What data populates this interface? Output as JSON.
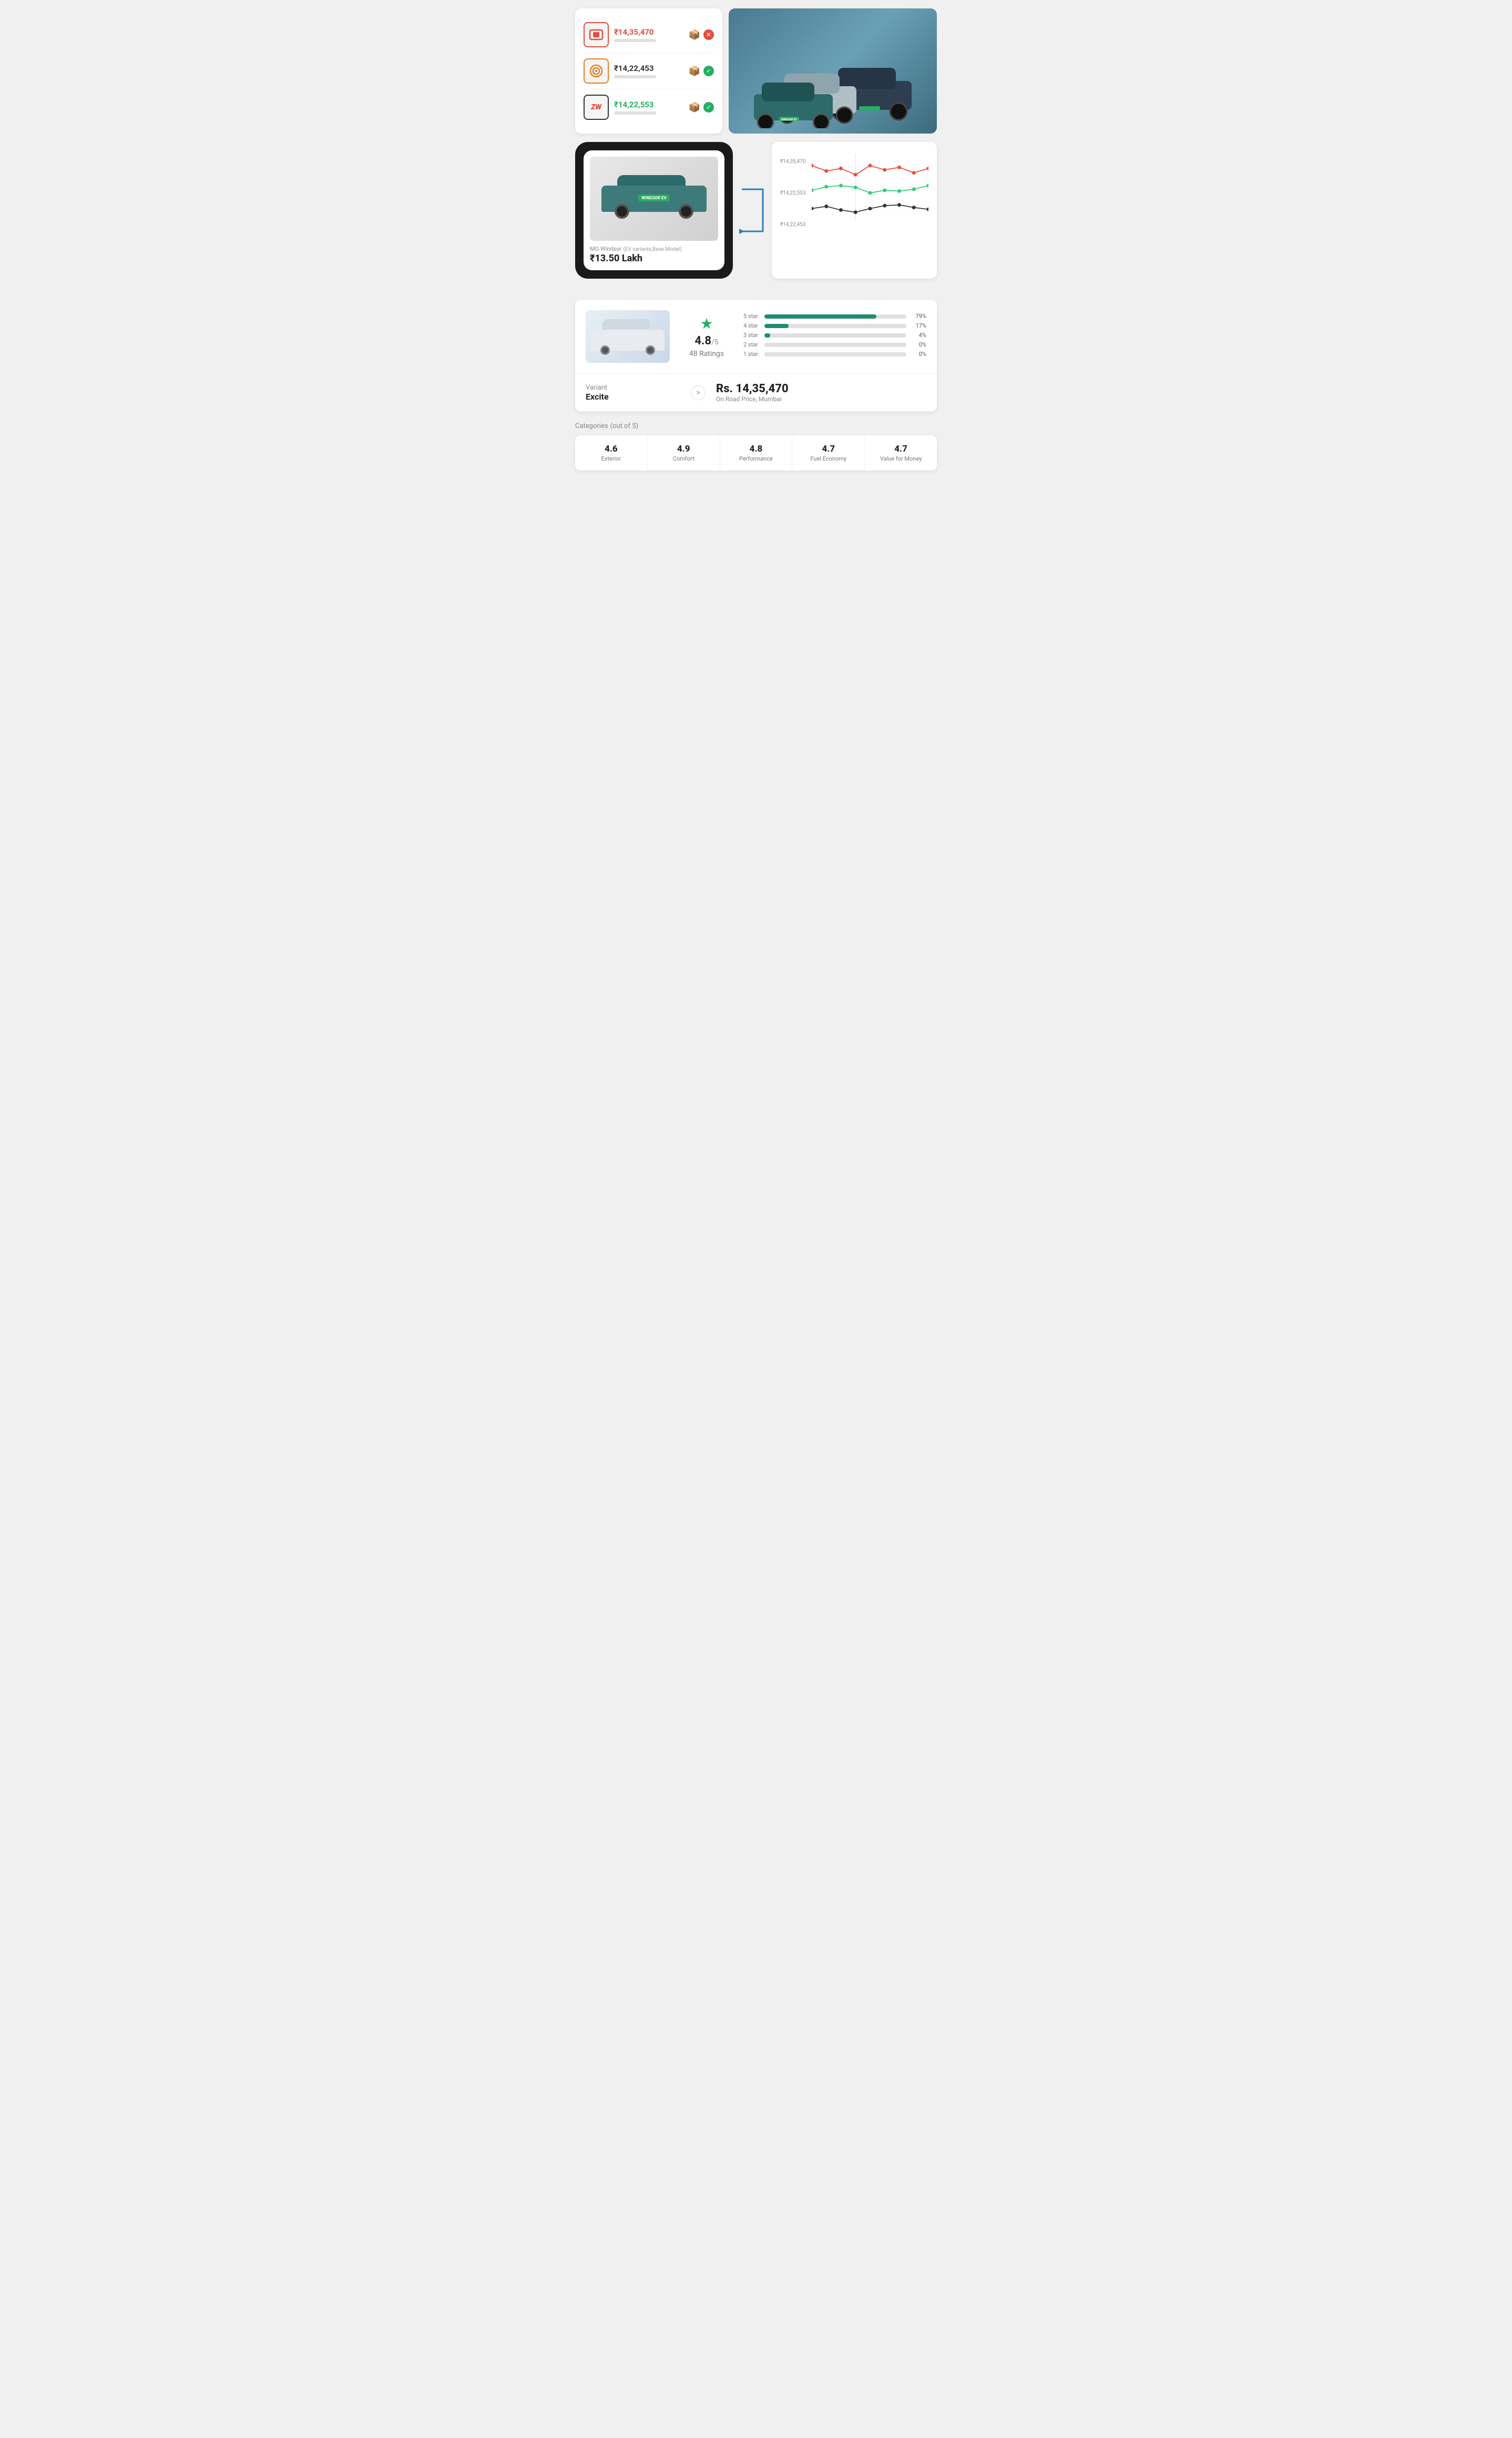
{
  "priceCard": {
    "brands": [
      {
        "logoText": "□",
        "logoStyle": "red",
        "price": "₹14,35,470",
        "priceStyle": "red",
        "barWidth": "65%",
        "status": "cross",
        "statusStyle": "red-bg"
      },
      {
        "logoText": "◎",
        "logoStyle": "orange",
        "price": "₹14,22,453",
        "priceStyle": "black",
        "barWidth": "50%",
        "status": "check",
        "statusStyle": "green-bg"
      },
      {
        "logoText": "ZW",
        "logoStyle": "dark",
        "price": "₹14,22,553",
        "priceStyle": "green",
        "barWidth": "50%",
        "status": "check",
        "statusStyle": "green-bg"
      }
    ]
  },
  "carShowcase": {
    "carName": "MG Windsor",
    "carSubname": "(EV variants,Base Model)",
    "carPrice": "₹13.50 Lakh"
  },
  "chart": {
    "labels": [
      "₹14,35,470",
      "₹14,22,553",
      "₹14,22,453"
    ],
    "series": [
      {
        "color": "#e74c3c",
        "points": [
          0,
          15,
          12,
          20,
          10,
          15,
          8,
          18,
          22
        ]
      },
      {
        "color": "#2ecc71",
        "points": [
          35,
          30,
          28,
          32,
          40,
          35,
          38,
          32,
          28
        ]
      },
      {
        "color": "#333333",
        "points": [
          55,
          52,
          58,
          60,
          55,
          50,
          48,
          52,
          56
        ]
      }
    ]
  },
  "rating": {
    "score": "4.8",
    "outOf": "/5",
    "count": "48 Ratings",
    "starIcon": "★",
    "bars": [
      {
        "label": "5 star",
        "pct": 79,
        "display": "79%"
      },
      {
        "label": "4 star",
        "pct": 17,
        "display": "17%"
      },
      {
        "label": "3 star",
        "pct": 4,
        "display": "4%"
      },
      {
        "label": "2 star",
        "pct": 0,
        "display": "0%"
      },
      {
        "label": "1 star",
        "pct": 0,
        "display": "0%"
      }
    ]
  },
  "variant": {
    "label": "Variant",
    "name": "Excite",
    "arrowLabel": ">",
    "price": "Rs. 14,35,470",
    "priceSub": "On Road Price, Mumbai"
  },
  "categories": {
    "title": "Categories",
    "outOf": "(out of 5)",
    "items": [
      {
        "score": "4.6",
        "name": "Exterior"
      },
      {
        "score": "4.9",
        "name": "Comfort"
      },
      {
        "score": "4.8",
        "name": "Performance"
      },
      {
        "score": "4.7",
        "name": "Fuel Economy"
      },
      {
        "score": "4.7",
        "name": "Value for Money"
      }
    ]
  }
}
